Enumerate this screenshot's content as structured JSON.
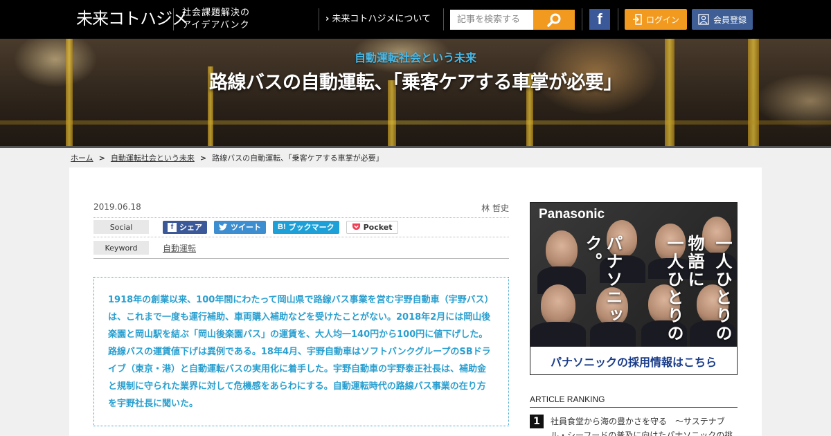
{
  "header": {
    "logo": "未来コトハジメ",
    "tagline_line1": "社会課題解決の",
    "tagline_line2": "アイデアバンク",
    "about_link": "未来コトハジメについて",
    "search_placeholder": "記事を検索する",
    "facebook_label": "f",
    "login_label": "ログイン",
    "register_label": "会員登録"
  },
  "hero": {
    "category": "自動運転社会という未来",
    "title": "路線バスの自動運転、「乗客ケアする車掌が必要」"
  },
  "breadcrumb": {
    "home": "ホーム",
    "category": "自動運転社会という未来",
    "current": "路線バスの自動運転、「乗客ケアする車掌が必要」"
  },
  "article": {
    "date": "2019.06.18",
    "author": "林 哲史",
    "social_label": "Social",
    "share_facebook": "シェア",
    "share_twitter": "ツイート",
    "share_hatena": "ブックマーク",
    "share_pocket": "Pocket",
    "keyword_label": "Keyword",
    "keyword": "自動運転",
    "summary": "1918年の創業以来、100年間にわたって岡山県で路線バス事業を営む宇野自動車（宇野バス）は、これまで一度も運行補助、車両購入補助などを受けたことがない。2018年2月には岡山後楽園と岡山駅を結ぶ「岡山後楽園バス」の運賃を、大人均一140円から100円に値下げした。路線バスの運賃値下げは異例である。18年4月、宇野自動車はソフトバンクグループのSBドライブ（東京・港）と自動運転バスの実用化に着手した。宇野自動車の宇野泰正社長は、補助金と規制に守られた業界に対して危機感をあらわにする。自動運転時代の路線バス事業の在り方を宇野社長に聞いた。"
  },
  "ad": {
    "brand": "Panasonic",
    "copy_col1": "一人ひとりの",
    "copy_col2": "物語に",
    "copy_col3": "一人ひとりの",
    "copy_col4": "パナソニック。",
    "cta": "パナソニックの採用情報はこちら"
  },
  "ranking": {
    "title": "ARTICLE RANKING",
    "items": [
      {
        "rank": "1",
        "text": "社員食堂から海の豊かさを守る　～サステナブル・シーフードの普及に向けたパナソニックの挑"
      }
    ]
  }
}
